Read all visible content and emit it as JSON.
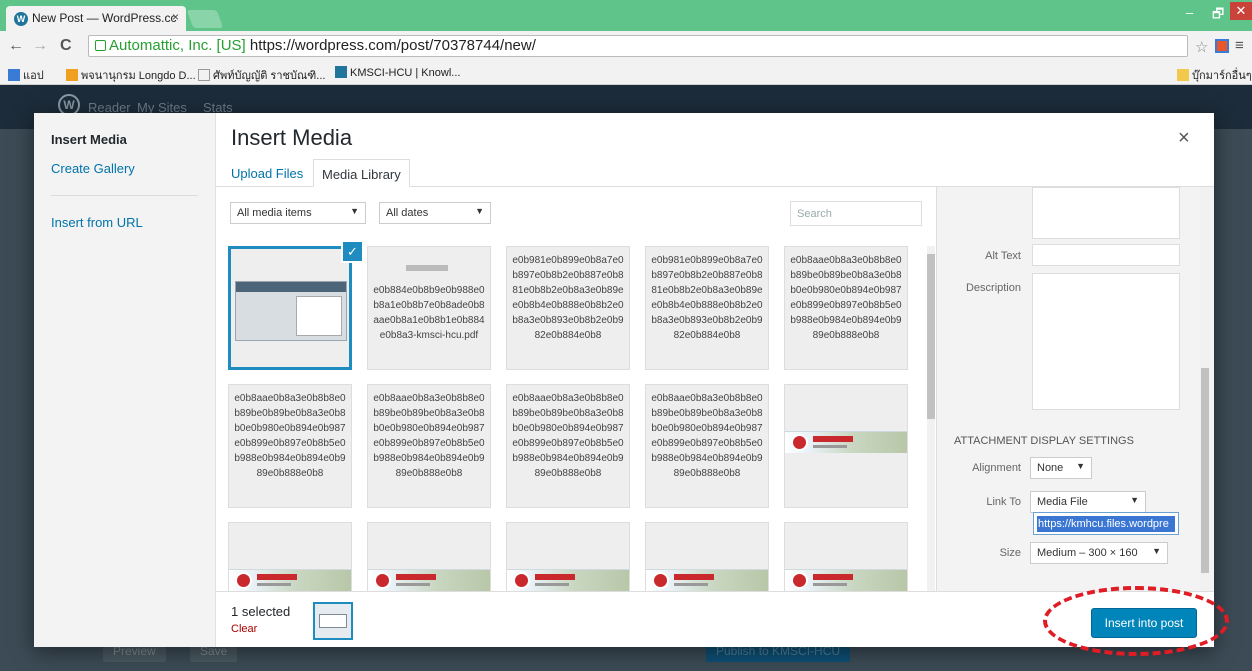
{
  "browser": {
    "tab_title": "New Post — WordPress.cc",
    "tab_close": "×",
    "favicon": "W",
    "win_min": "‒",
    "win_max": "🗗",
    "win_close": "✕",
    "nav_back": "←",
    "nav_forward": "→",
    "nav_reload": "C",
    "secure_label": "Automattic, Inc. [US]",
    "url": "https://wordpress.com/post/70378744/new/",
    "star": "☆",
    "menu": "≡",
    "bookmarks": [
      {
        "label": "แอป",
        "color": "#3a7bd5"
      },
      {
        "label": "พจนานุกรม Longdo D...",
        "color": "#f0a020"
      },
      {
        "label": "ศัพท์บัญญัติ ราชบัณฑิ...",
        "color": "#999999"
      },
      {
        "label": "KMSCI-HCU | Knowl...",
        "color": "#21759b"
      }
    ],
    "bookmarks_right": "บุ๊กมาร์กอื่นๆ"
  },
  "wp_admin": {
    "logo": "W",
    "items": [
      "Reader",
      "My Sites",
      "Stats"
    ],
    "preview_btn": "Preview",
    "save_btn": "Save",
    "publish_btn": "Publish to KMSCI-HCU"
  },
  "modal": {
    "menu": {
      "insert_media": "Insert Media",
      "create_gallery": "Create Gallery",
      "insert_from_url": "Insert from URL"
    },
    "title": "Insert Media",
    "close": "×",
    "tabs": {
      "upload": "Upload Files",
      "library": "Media Library"
    },
    "filters": {
      "media": "All media items",
      "dates": "All dates",
      "caret": "▼"
    },
    "search_placeholder": "Search",
    "check": "✓",
    "items": [
      {
        "kind": "screenshot"
      },
      {
        "kind": "pdf",
        "text": "e0b884e0b8b9e0b988e0b8a1e0b8b7e0b8ade0b8aae0b8a1e0b8b1e0b884e0b8a3-kmsci-hcu.pdf"
      },
      {
        "kind": "text",
        "text": "e0b981e0b899e0b8a7e0b897e0b8b2e0b887e0b881e0b8b2e0b8a3e0b89ee0b8b4e0b888e0b8b2e0b8a3e0b893e0b8b2e0b982e0b884e0b8"
      },
      {
        "kind": "text",
        "text": "e0b981e0b899e0b8a7e0b897e0b8b2e0b887e0b881e0b8b2e0b8a3e0b89ee0b8b4e0b888e0b8b2e0b8a3e0b893e0b8b2e0b982e0b884e0b8"
      },
      {
        "kind": "text",
        "text": "e0b8aae0b8a3e0b8b8e0b89be0b89be0b8a3e0b8b0e0b980e0b894e0b987e0b899e0b897e0b8b5e0b988e0b984e0b894e0b989e0b888e0b8"
      },
      {
        "kind": "text",
        "text": "e0b8aae0b8a3e0b8b8e0b89be0b89be0b8a3e0b8b0e0b980e0b894e0b987e0b899e0b897e0b8b5e0b988e0b984e0b894e0b989e0b888e0b8"
      },
      {
        "kind": "text",
        "text": "e0b8aae0b8a3e0b8b8e0b89be0b89be0b8a3e0b8b0e0b980e0b894e0b987e0b899e0b897e0b8b5e0b988e0b984e0b894e0b989e0b888e0b8"
      },
      {
        "kind": "text",
        "text": "e0b8aae0b8a3e0b8b8e0b89be0b89be0b8a3e0b8b0e0b980e0b894e0b987e0b899e0b897e0b8b5e0b988e0b984e0b894e0b989e0b888e0b8"
      },
      {
        "kind": "text",
        "text": "e0b8aae0b8a3e0b8b8e0b89be0b89be0b8a3e0b8b0e0b980e0b894e0b987e0b899e0b897e0b8b5e0b988e0b984e0b894e0b989e0b888e0b8"
      },
      {
        "kind": "banner"
      },
      {
        "kind": "banner"
      },
      {
        "kind": "banner"
      },
      {
        "kind": "banner"
      },
      {
        "kind": "banner"
      },
      {
        "kind": "banner"
      }
    ],
    "sidebar": {
      "alt_text_label": "Alt Text",
      "description_label": "Description",
      "display_heading": "ATTACHMENT DISPLAY SETTINGS",
      "alignment_label": "Alignment",
      "alignment_value": "None",
      "link_to_label": "Link To",
      "link_to_value": "Media File",
      "link_url": "https://kmhcu.files.wordpre",
      "size_label": "Size",
      "size_value": "Medium – 300 × 160"
    },
    "footer": {
      "selected": "1 selected",
      "clear": "Clear",
      "insert_button": "Insert into post"
    }
  },
  "colors": {
    "accent": "#0085ba",
    "tab_bar": "#5ec489",
    "annotation": "#e01c24"
  }
}
